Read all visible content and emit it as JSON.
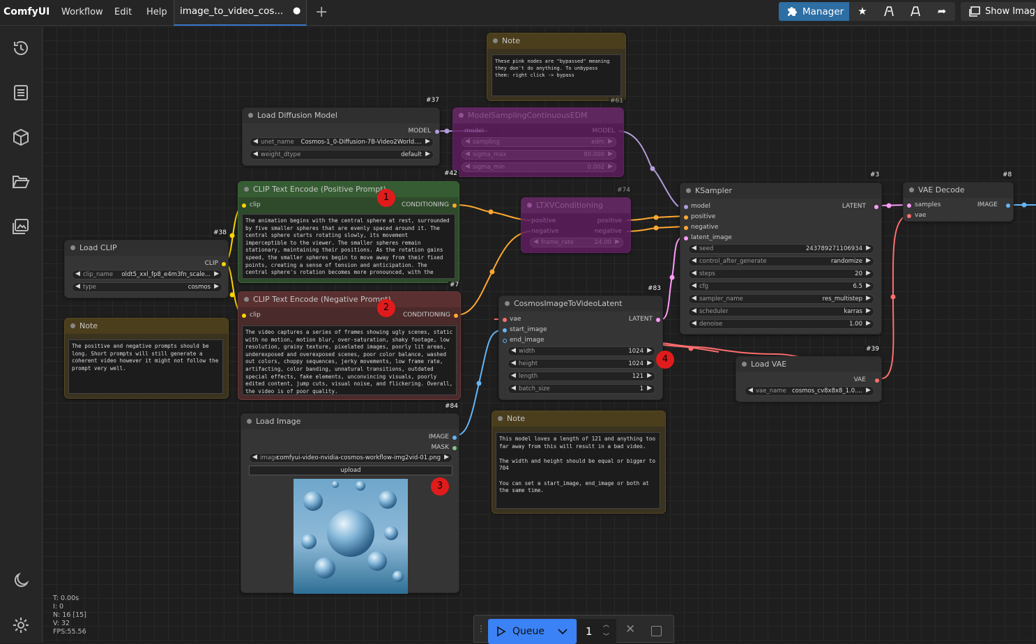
{
  "app": {
    "name": "ComfyUI"
  },
  "menu": [
    "Workflow",
    "Edit",
    "Help"
  ],
  "tab": {
    "title": "image_to_video_cos...",
    "modified": "●"
  },
  "toolbar": {
    "manager": "Manager",
    "show_image": "Show Image"
  },
  "nodes": {
    "note_top": {
      "title": "Note",
      "text": "These pink nodes are \"bypassed\" meaning\nthey don't do anything. To unbypass\nthem: right click -> bypass"
    },
    "load_diffusion": {
      "id": "#37",
      "title": "Load Diffusion Model",
      "out": "MODEL",
      "w_unet_label": "unet_name",
      "w_unet_value": "Cosmos-1_0-Diffusion-7B-Video2World....",
      "w_dtype_label": "weight_dtype",
      "w_dtype_value": "default"
    },
    "model_sampling": {
      "id": "#61",
      "title": "ModelSamplingContinuousEDM",
      "in": "model",
      "out": "MODEL",
      "w1_label": "sampling",
      "w1_value": "edm",
      "w2_label": "sigma_max",
      "w2_value": "80.000",
      "w3_label": "sigma_min",
      "w3_value": "0.002"
    },
    "clip_pos": {
      "id": "#42",
      "title": "CLIP Text Encode (Positive Prompt)",
      "in": "clip",
      "out": "CONDITIONING",
      "text": "The animation begins with the central sphere at rest, surrounded by five smaller spheres that are evenly spaced around it. The central sphere starts rotating slowly, its movement imperceptible to the viewer. The smaller spheres remain stationary, maintaining their positions. As the rotation gains speed, the smaller spheres begin to move away from their fixed points, creating a sense of tension and anticipation. The central sphere's rotation becomes more pronounced, with the"
    },
    "ltxv": {
      "id": "#74",
      "title": "LTXVConditioning",
      "in1": "positive",
      "in2": "negative",
      "out1": "positive",
      "out2": "negative",
      "w_label": "frame_rate",
      "w_value": "24.00"
    },
    "ksampler": {
      "id": "#3",
      "title": "KSampler",
      "in1": "model",
      "in2": "positive",
      "in3": "negative",
      "in4": "latent_image",
      "out": "LATENT",
      "widgets": [
        [
          "seed",
          "243789271106934"
        ],
        [
          "control_after_generate",
          "randomize"
        ],
        [
          "steps",
          "20"
        ],
        [
          "cfg",
          "6.5"
        ],
        [
          "sampler_name",
          "res_multistep"
        ],
        [
          "scheduler",
          "karras"
        ],
        [
          "denoise",
          "1.00"
        ]
      ]
    },
    "vae_decode": {
      "id": "#8",
      "title": "VAE Decode",
      "in1": "samples",
      "in2": "vae",
      "out": "IMAGE"
    },
    "load_clip": {
      "id": "#38",
      "title": "Load CLIP",
      "out": "CLIP",
      "w1_label": "clip_name",
      "w1_value": "oldt5_xxl_fp8_e4m3fn_scale...",
      "w2_label": "type",
      "w2_value": "cosmos"
    },
    "note_left": {
      "title": "Note",
      "text": "The positive and negative prompts should be long. Short prompts will still generate a coherent video however it might not follow the prompt very well."
    },
    "clip_neg": {
      "id": "#7",
      "title": "CLIP Text Encode (Negative Prompt)",
      "in": "clip",
      "out": "CONDITIONING",
      "text": "The video captures a series of frames showing ugly scenes, static with no motion, motion blur, over-saturation, shaky footage, low resolution, grainy texture, pixelated images, poorly lit areas, underexposed and overexposed scenes, poor color balance, washed out colors, choppy sequences, jerky movements, low frame rate, artifacting, color banding, unnatural transitions, outdated special effects, fake elements, unconvincing visuals, poorly edited content, jump cuts, visual noise, and flickering. Overall, the video is of poor quality."
    },
    "cosmos_latent": {
      "id": "#83",
      "title": "CosmosImageToVideoLatent",
      "in1": "vae",
      "in2": "start_image",
      "in3": "end_image",
      "out": "LATENT",
      "widgets": [
        [
          "width",
          "1024"
        ],
        [
          "height",
          "1024"
        ],
        [
          "length",
          "121"
        ],
        [
          "batch_size",
          "1"
        ]
      ]
    },
    "load_vae": {
      "id": "#39",
      "title": "Load VAE",
      "out": "VAE",
      "w_label": "vae_name",
      "w_value": "cosmos_cv8x8x8_1.0...."
    },
    "load_image": {
      "id": "#84",
      "title": "Load Image",
      "out1": "IMAGE",
      "out2": "MASK",
      "w_label": "image",
      "w_value": "comfyui-video-nvidia-cosmos-workflow-img2vid-01.png",
      "upload": "upload"
    },
    "note_bottom": {
      "title": "Note",
      "text": "This model loves a length of 121 and anything too far away from this will result in a bad video.\n\nThe width and height should be equal or bigger to 704\n\nYou can set a start_image, end_image or both at the same time."
    }
  },
  "badges": [
    "1",
    "2",
    "3",
    "4"
  ],
  "stats": {
    "t": "T: 0.00s",
    "i": "I: 0",
    "n": "N: 16 [15]",
    "v": "V: 32",
    "fps": "FPS:55.56"
  },
  "queue": {
    "label": "Queue",
    "count": "1"
  },
  "colors": {
    "accent": "#3b7bd1",
    "clip_link": "#ffd500",
    "cond_link": "#ffa931",
    "model_link": "#b39ddb",
    "latent_link": "#ff9cf9",
    "vae_link": "#ff6e6e",
    "image_link": "#64b5f6"
  }
}
